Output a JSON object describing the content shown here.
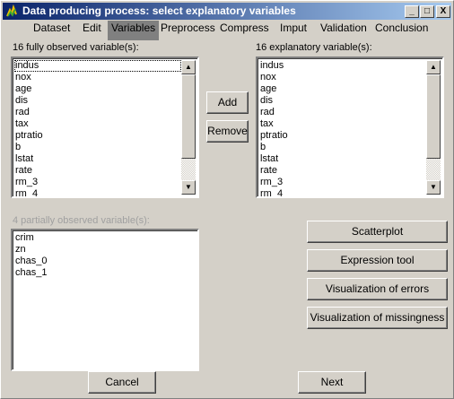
{
  "window": {
    "title": "Data producing process: select explanatory variables",
    "controls": [
      "_",
      "□",
      "X"
    ]
  },
  "tabs": [
    "Dataset",
    "Edit",
    "Variables",
    "Preprocess",
    "Compress",
    "Imput",
    "Validation",
    "Conclusion"
  ],
  "active_tab": "Variables",
  "left_list": {
    "label": "16 fully observed variable(s):",
    "items": [
      "indus",
      "nox",
      "age",
      "dis",
      "rad",
      "tax",
      "ptratio",
      "b",
      "lstat",
      "rate",
      "rm_3",
      "rm_4"
    ]
  },
  "right_list": {
    "label": "16 explanatory variable(s):",
    "items": [
      "indus",
      "nox",
      "age",
      "dis",
      "rad",
      "tax",
      "ptratio",
      "b",
      "lstat",
      "rate",
      "rm_3",
      "rm_4"
    ]
  },
  "partial_list": {
    "label": "4 partially observed variable(s):",
    "items": [
      "crim",
      "zn",
      "chas_0",
      "chas_1"
    ]
  },
  "buttons": {
    "add": "Add",
    "remove": "Remove",
    "scatterplot": "Scatterplot",
    "expression_tool": "Expression tool",
    "viz_errors": "Visualization of errors",
    "viz_missingness": "Visualization of missingness",
    "cancel": "Cancel",
    "next": "Next"
  },
  "icons": {
    "scroll_up": "▲",
    "scroll_down": "▼"
  }
}
